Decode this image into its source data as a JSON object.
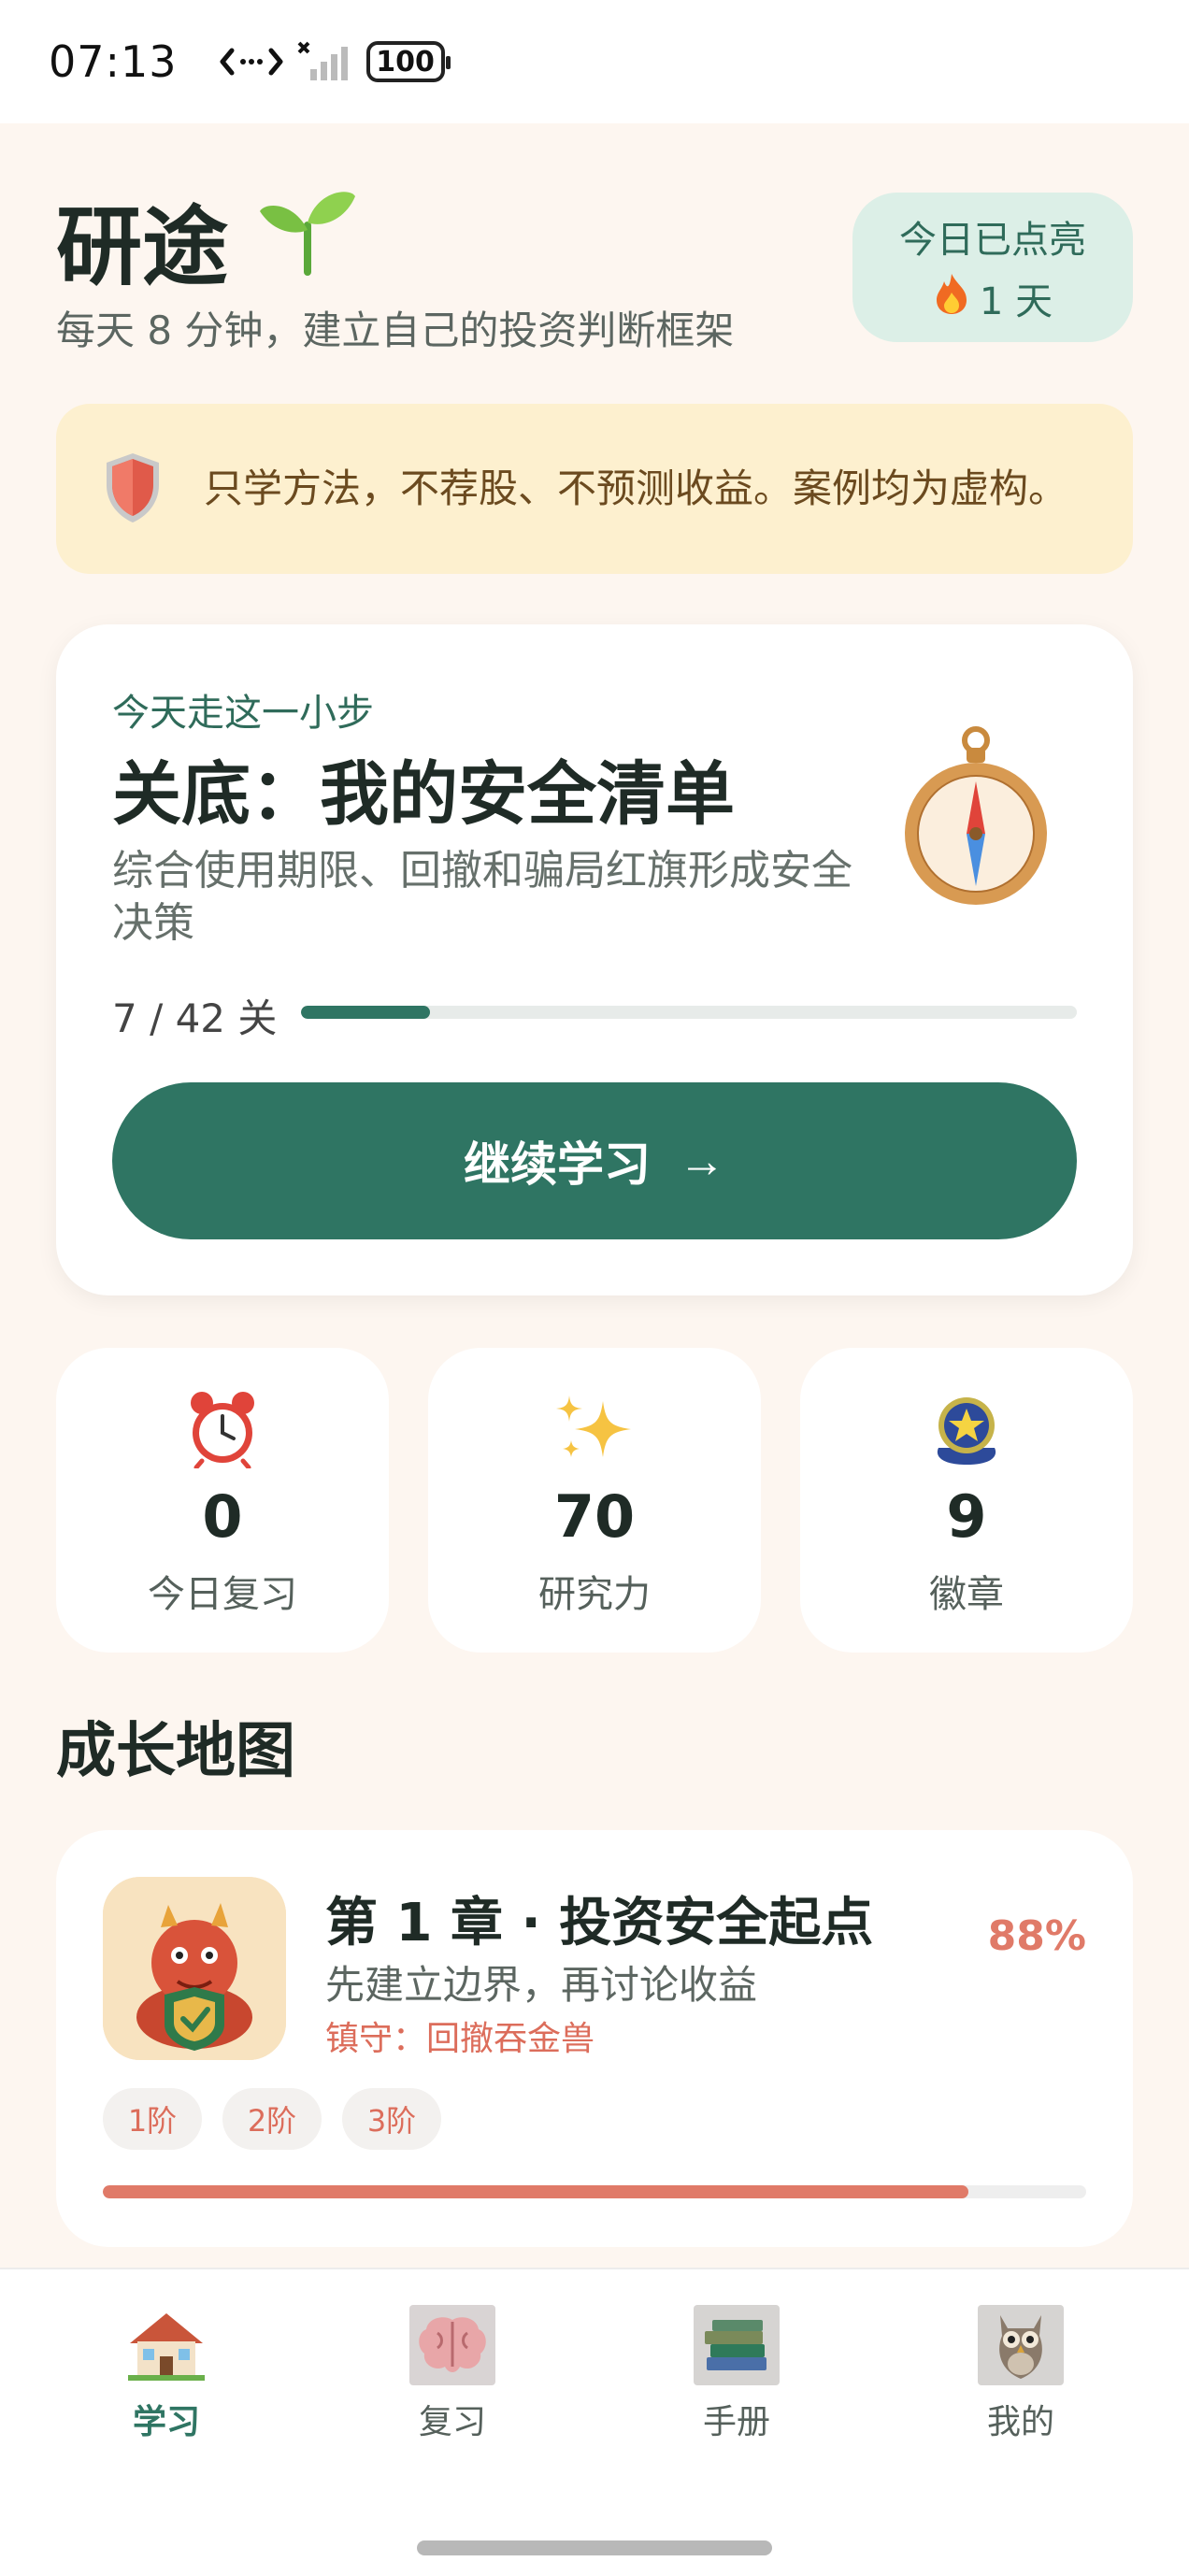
{
  "status_bar": {
    "time": "07:13",
    "battery": "100"
  },
  "header": {
    "title": "研途",
    "subtitle": "每天 8 分钟，建立自己的投资判断框架",
    "streak_label": "今日已点亮",
    "streak_days": "1 天"
  },
  "disclaimer": {
    "text": "只学方法，不荐股、不预测收益。案例均为虚构。"
  },
  "lesson_card": {
    "kicker": "今天走这一小步",
    "title": "关底：我的安全清单",
    "description": "综合使用期限、回撤和骗局红旗形成安全决策",
    "progress_label": "7 / 42 关",
    "progress_fraction": 0.1667,
    "continue_label": "继续学习",
    "continue_arrow": "→"
  },
  "stats": [
    {
      "icon": "alarm-clock-icon",
      "value": "0",
      "label": "今日复习"
    },
    {
      "icon": "sparkles-icon",
      "value": "70",
      "label": "研究力"
    },
    {
      "icon": "badge-icon",
      "value": "9",
      "label": "徽章"
    }
  ],
  "growth_map": {
    "section_title": "成长地图",
    "chapter": {
      "title": "第 1 章 · 投资安全起点",
      "description": "先建立边界，再讨论收益",
      "guardian": "镇守：回撤吞金兽",
      "percent": "88%",
      "progress_fraction": 0.88,
      "stages": [
        "1阶",
        "2阶",
        "3阶"
      ]
    }
  },
  "bottom_nav": {
    "items": [
      {
        "label": "学习",
        "icon": "house-icon",
        "active": true
      },
      {
        "label": "复习",
        "icon": "brain-icon",
        "active": false
      },
      {
        "label": "手册",
        "icon": "books-icon",
        "active": false
      },
      {
        "label": "我的",
        "icon": "owl-icon",
        "active": false
      }
    ]
  },
  "colors": {
    "primary": "#2f7563",
    "accent": "#e07a68",
    "background": "#fdf6f0",
    "disclaimer_bg": "#fdf0cf",
    "streak_bg": "#dcefe7"
  }
}
